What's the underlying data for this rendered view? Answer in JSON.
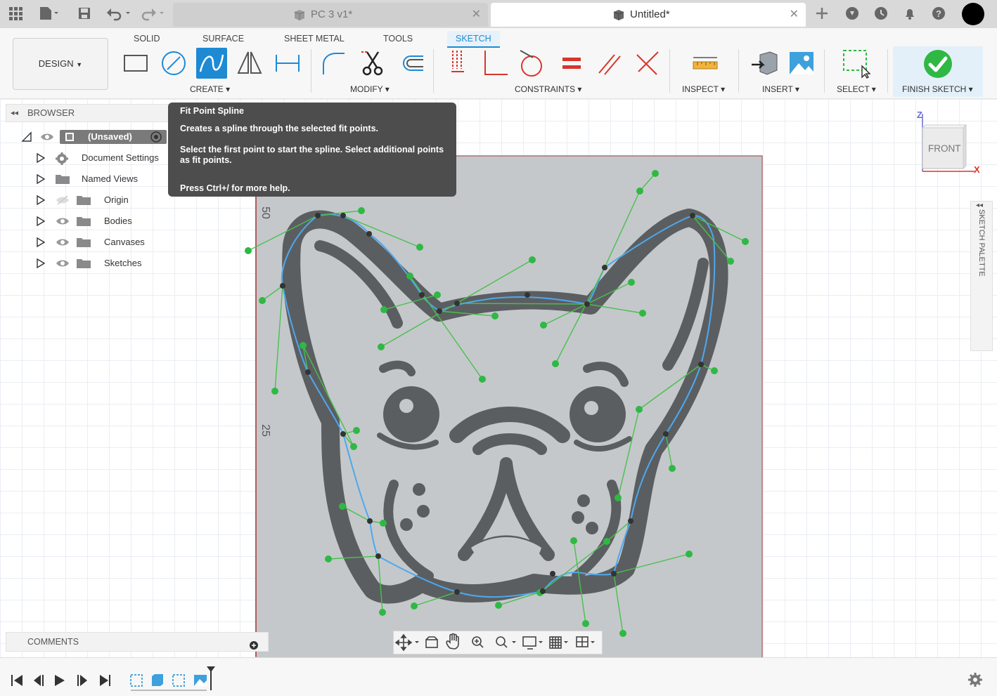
{
  "titlebar": {
    "tabs": [
      {
        "label": "PC 3 v1*",
        "active": false
      },
      {
        "label": "Untitled*",
        "active": true
      }
    ]
  },
  "toolbar": {
    "design_label": "DESIGN",
    "workspace_tabs": [
      "SOLID",
      "SURFACE",
      "SHEET METAL",
      "TOOLS",
      "SKETCH"
    ],
    "active_tab": "SKETCH",
    "groups": {
      "create": "CREATE",
      "modify": "MODIFY",
      "constraints": "CONSTRAINTS",
      "inspect": "INSPECT",
      "insert": "INSERT",
      "select": "SELECT",
      "finish": "FINISH SKETCH"
    }
  },
  "browser": {
    "title": "BROWSER",
    "root": "(Unsaved)",
    "items": [
      "Document Settings",
      "Named Views",
      "Origin",
      "Bodies",
      "Canvases",
      "Sketches"
    ]
  },
  "tooltip": {
    "title": "Fit Point Spline",
    "line1": "Creates a spline through the selected fit points.",
    "line2": "Select the first point to start the spline. Select additional points as fit points.",
    "line3": "Press Ctrl+/ for more help."
  },
  "viewcube": {
    "face": "FRONT",
    "axis_z": "Z",
    "axis_x": "X"
  },
  "ruler": {
    "label_50": "50",
    "label_25": "25"
  },
  "sketch_palette": "SKETCH PALETTE",
  "comments": "COMMENTS",
  "colors": {
    "accent": "#1d8ad3",
    "finish_green": "#2fb844",
    "constraint_red": "#d9352b",
    "spline_green": "#2fb844"
  }
}
